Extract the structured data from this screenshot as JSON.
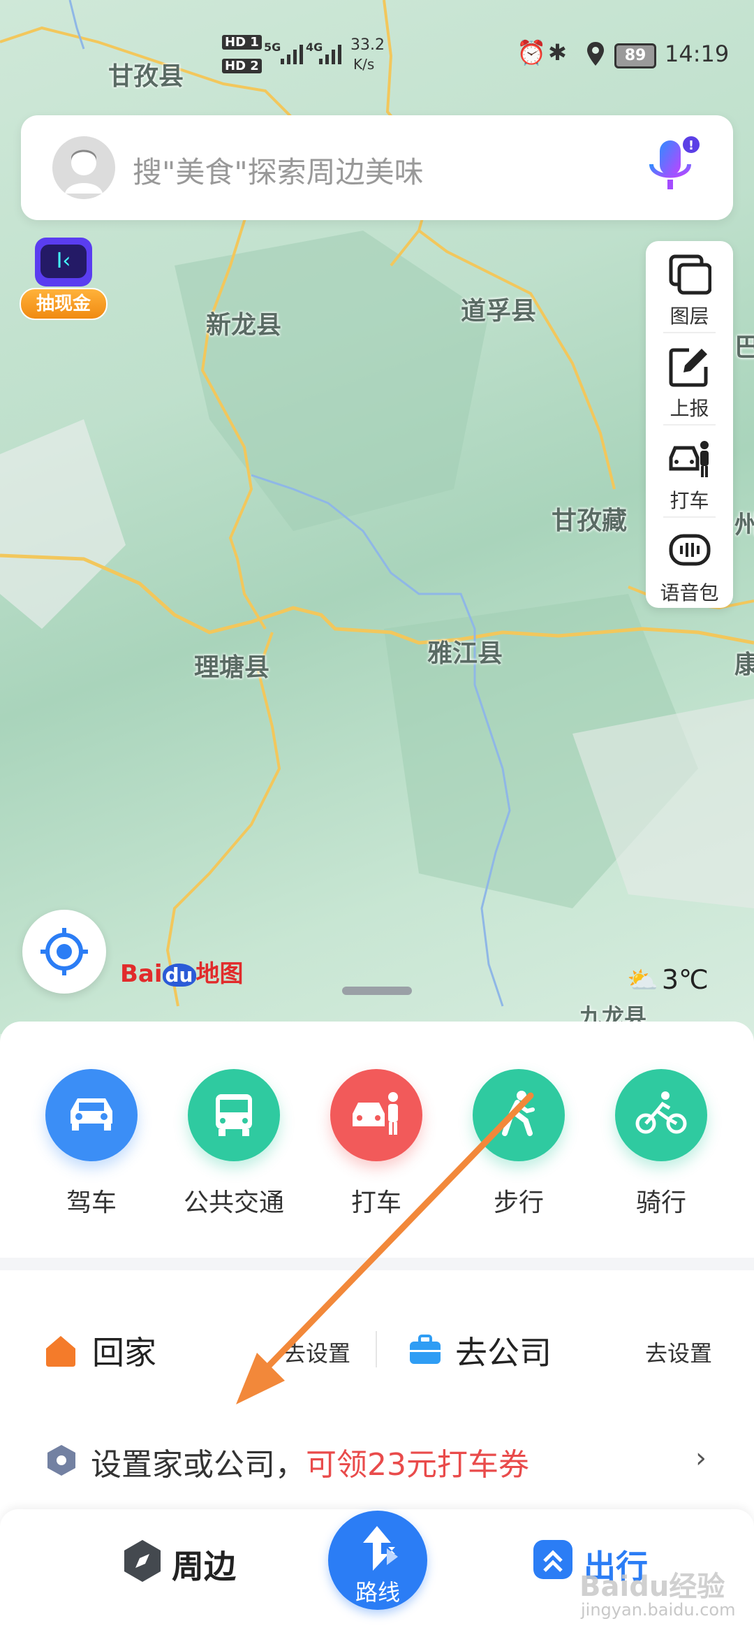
{
  "status_bar": {
    "sim1": "HD 1",
    "sim2": "HD 2",
    "net1": "5G",
    "net2": "4G",
    "speed": "33.2",
    "speed_unit": "K/s",
    "battery": "89",
    "time": "14:19"
  },
  "search": {
    "placeholder": "搜\"美食\"探索周边美味"
  },
  "promo_badge": {
    "label": "抽现金"
  },
  "map_labels": {
    "ganzi_county": "甘孜县",
    "xinlong": "新龙县",
    "daofu": "道孚县",
    "ganzi_pref": "甘孜藏",
    "litang": "理塘县",
    "yajiang": "雅江县",
    "kang": "康",
    "zhou": "州",
    "ba": "巴",
    "jiulong": "九龙县"
  },
  "tools": {
    "layers": "图层",
    "report": "上报",
    "taxi": "打车",
    "voice": "语音包"
  },
  "brand": {
    "bai": "Bai",
    "du": "du",
    "map": "地图"
  },
  "weather": {
    "temp": "3℃"
  },
  "modes": [
    {
      "label": "驾车",
      "color": "#3b8ef6"
    },
    {
      "label": "公共交通",
      "color": "#2fcaa0"
    },
    {
      "label": "打车",
      "color": "#f25a5a"
    },
    {
      "label": "步行",
      "color": "#2fcaa0"
    },
    {
      "label": "骑行",
      "color": "#2fcaa0"
    }
  ],
  "shortcuts": {
    "home": "回家",
    "home_set": "去设置",
    "work": "去公司",
    "work_set": "去设置"
  },
  "promo": {
    "text": "设置家或公司，",
    "highlight": "可领23元打车券"
  },
  "tabbar": {
    "nearby": "周边",
    "route": "路线",
    "travel": "出行"
  },
  "watermark": {
    "line1": "Baidu经验",
    "line2": "jingyan.baidu.com"
  }
}
